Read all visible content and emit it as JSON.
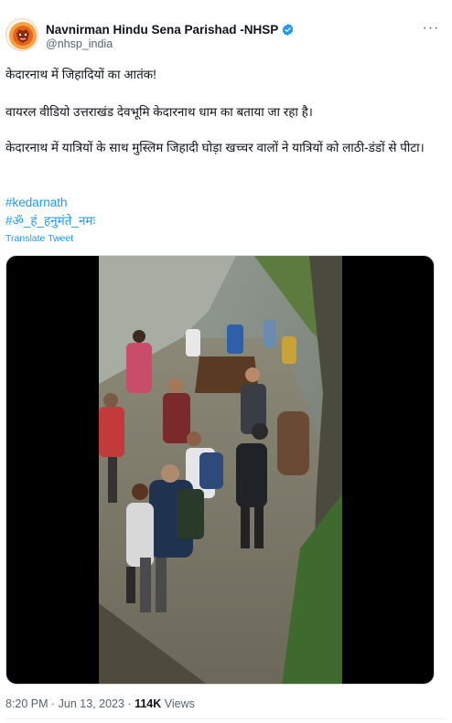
{
  "author": {
    "display_name": "Navnirman Hindu Sena Parishad -NHSP",
    "handle": "@nhsp_india",
    "verified_color": "#1d9bf0",
    "avatar_icon": "lion-emblem-icon"
  },
  "more_label": "···",
  "tweet": {
    "line1": "केदारनाथ में जिहादियों का आतंक!",
    "line2": "वायरल वीडियो उत्तराखंड देवभूमि केदारनाथ धाम का बताया जा रहा है।",
    "line3": "केदारनाथ में यात्रियों के साथ मुस्लिम जिहादी घोड़ा खच्चर वालों ने यात्रियों को लाठी-डंडों से पीटा।",
    "hashtags": [
      "#kedarnath",
      "#ॐ_हं_हनुमंते_नमः"
    ],
    "translate_label": "Translate Tweet"
  },
  "media": {
    "type": "video",
    "background": "#000000"
  },
  "footer": {
    "time": "8:20 PM",
    "separator1": " · ",
    "date": "Jun 13, 2023",
    "separator2": " · ",
    "views_count": "114K",
    "views_label": " Views"
  },
  "colors": {
    "link": "#1d9bf0",
    "secondary_text": "#536471",
    "primary_text": "#0f1419"
  }
}
